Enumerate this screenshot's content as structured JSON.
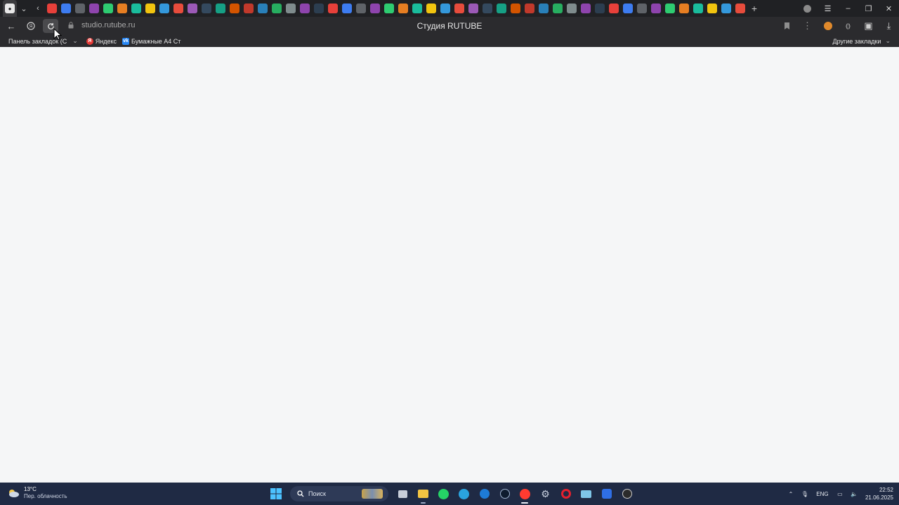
{
  "browser": {
    "tab_icon_colors": [
      "#e7403a",
      "#3d7cf0",
      "#5f6368",
      "#8e44ad",
      "#2ecc71",
      "#e67e22",
      "#1abc9c",
      "#f1c40f",
      "#3498db",
      "#e74c3c",
      "#9b59b6",
      "#34495e",
      "#16a085",
      "#d35400",
      "#c0392b",
      "#2980b9",
      "#27ae60",
      "#7f8c8d",
      "#8e44ad",
      "#2c3e50"
    ],
    "url": "studio.rutube.ru",
    "title": "Студия RUTUBE",
    "bookmarks": {
      "panel_label": "Панель закладок (С",
      "items": [
        {
          "label": "Яндекс",
          "icon": "yandex-icon",
          "color": "#e53935"
        },
        {
          "label": "Бумажные А4 Ст",
          "icon": "vk-icon",
          "color": "#2787f5"
        }
      ],
      "other": "Другие закладки"
    }
  },
  "taskbar": {
    "weather": {
      "temp": "13°C",
      "desc": "Пер. облачность"
    },
    "search_placeholder": "Поиск",
    "lang": "ENG",
    "time": "22:52",
    "date": "21.06.2025"
  }
}
